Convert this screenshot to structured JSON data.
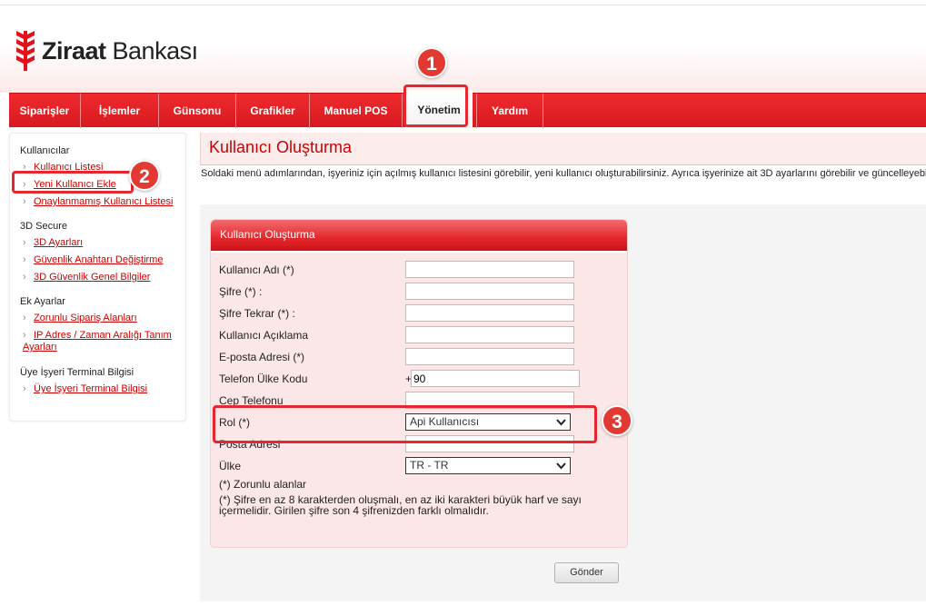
{
  "brand": {
    "name_bold": "Ziraat",
    "name_rest": " Bankası",
    "color": "#e2111a"
  },
  "nav": {
    "items": [
      {
        "label": "Siparişler"
      },
      {
        "label": "İşlemler"
      },
      {
        "label": "Günsonu"
      },
      {
        "label": "Grafikler"
      },
      {
        "label": "Manuel POS"
      },
      {
        "label": "Yönetim",
        "active": true
      },
      {
        "label": "Yardım"
      }
    ]
  },
  "annotations": [
    "1",
    "2",
    "3"
  ],
  "sidebar": {
    "sections": [
      {
        "title": "Kullanıcılar",
        "links": [
          "Kullanıcı Listesi",
          "Yeni Kullanıcı Ekle",
          "Onaylanmamış Kullanıcı Listesi"
        ]
      },
      {
        "title": "3D Secure",
        "links": [
          "3D Ayarları",
          "Güvenlik Anahtarı Değiştirme",
          "3D Güvenlik Genel Bilgiler"
        ]
      },
      {
        "title": "Ek Ayarlar",
        "links": [
          "Zorunlu Sipariş Alanları",
          "IP Adres / Zaman Aralığı Tanım Ayarları"
        ]
      },
      {
        "title": "Üye İşyeri Terminal Bilgisi",
        "links": [
          "Üye İşyeri Terminal Bilgisi"
        ]
      }
    ]
  },
  "page": {
    "title": "Kullanıcı Oluşturma",
    "description": "Soldaki menü adımlarından, işyeriniz için açılmış kullanıcı listesini görebilir, yeni kullanıcı oluşturabilirsiniz. Ayrıca işyerinize ait 3D ayarlarını görebilir ve güncelleyebi"
  },
  "form": {
    "header": "Kullanıcı Oluşturma",
    "fields": {
      "username": "Kullanıcı Adı (*)",
      "password": "Şifre (*) :",
      "password_repeat": "Şifre Tekrar (*) :",
      "description": "Kullanıcı Açıklama",
      "email": "E-posta Adresi (*)",
      "phone_country": "Telefon Ülke Kodu",
      "phone_country_prefix": "+",
      "phone_country_value": "90",
      "mobile": "Cep Telefonu",
      "role": "Rol (*)",
      "role_value": "Api Kullanıcısı",
      "postal": "Posta Adresi",
      "country": "Ülke",
      "country_value": "TR - TR"
    },
    "note_required": "(*) Zorunlu alanlar",
    "note_password_1": "(*) Şifre en az 8 karakterden oluşmalı, en az iki karakteri büyük harf ve sayı",
    "note_password_2": "içermelidir. Girilen şifre son 4 şifrenizden farklı olmalıdır.",
    "submit": "Gönder"
  }
}
